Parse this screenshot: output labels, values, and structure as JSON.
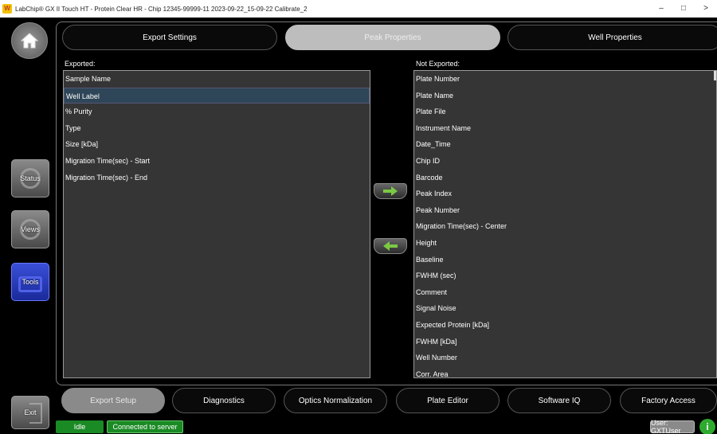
{
  "window": {
    "title": "LabChip® GX II Touch HT - Protein Clear HR - Chip 12345-99999-11 2023-09-22_15-09-22 Calibrate_2",
    "logo_text": "W",
    "controls": {
      "minimize": "–",
      "maximize": "□",
      "close": ">"
    }
  },
  "nav": {
    "status_label": "Status",
    "views_label": "Views",
    "tools_label": "Tools",
    "exit_label": "Exit"
  },
  "tabs": [
    {
      "label": "Export Settings",
      "active": false
    },
    {
      "label": "Peak Properties",
      "active": true
    },
    {
      "label": "Well Properties",
      "active": false
    }
  ],
  "exported": {
    "label": "Exported:",
    "items": [
      "Sample Name",
      "Well Label",
      "% Purity",
      "Type",
      "Size [kDa]",
      "Migration Time(sec) - Start",
      "Migration Time(sec) - End"
    ],
    "selected": "Well Label"
  },
  "not_exported": {
    "label": "Not Exported:",
    "items": [
      "Plate Number",
      "Plate Name",
      "Plate File",
      "Instrument Name",
      "Date_Time",
      "Chip ID",
      "Barcode",
      "Peak Index",
      "Peak Number",
      "Migration Time(sec) - Center",
      "Height",
      "Baseline",
      "FWHM (sec)",
      "Comment",
      "Signal Noise",
      "Expected Protein [kDa]",
      "FWHM [kDa]",
      "Well Number",
      "Corr. Area"
    ]
  },
  "bottom_tabs": [
    {
      "label": "Export Setup",
      "active": true
    },
    {
      "label": "Diagnostics",
      "active": false
    },
    {
      "label": "Optics Normalization",
      "active": false
    },
    {
      "label": "Plate Editor",
      "active": false
    },
    {
      "label": "Software IQ",
      "active": false
    },
    {
      "label": "Factory Access",
      "active": false
    }
  ],
  "status": {
    "state": "Idle",
    "connection": "Connected to server",
    "user": "User: GXTUser",
    "info_icon": "i"
  },
  "colors": {
    "accent_green": "#1a8a24",
    "arrow_green": "#7ac943",
    "tools_blue": "#2a3fc8"
  }
}
